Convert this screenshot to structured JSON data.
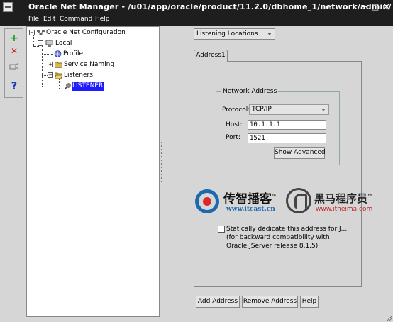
{
  "window": {
    "title": "Oracle Net Manager - /u01/app/oracle/product/11.2.0/dbhome_1/network/admin/",
    "buttons": {
      "minimize": "−",
      "maximize": "□",
      "close": "✕"
    }
  },
  "menu": {
    "file": "File",
    "edit": "Edit",
    "command": "Command",
    "help": "Help"
  },
  "toolbar": {
    "create_glyph": "+",
    "delete_glyph": "✕",
    "help_glyph": "?",
    "create_color": "#1a9b1a",
    "delete_color": "#d01818",
    "help_color": "#1a3fb0"
  },
  "tree": {
    "root": "Oracle Net Configuration",
    "local": "Local",
    "profile": "Profile",
    "service_naming": "Service Naming",
    "listeners": "Listeners",
    "listener": "LISTENER"
  },
  "view_selector": {
    "selected": "Listening Locations"
  },
  "tabs": {
    "address1": "Address1"
  },
  "network_address": {
    "group_title": "Network Address",
    "protocol_label": "Protocol:",
    "protocol_value": "TCP/IP",
    "host_label": "Host:",
    "host_value": "10.1.1.1",
    "port_label": "Port:",
    "port_value": "1521",
    "show_advanced": "Show Advanced"
  },
  "watermarks": {
    "itcast_name": "传智播客",
    "itcast_tm": "™",
    "itcast_url": "www.itcast.cn",
    "itheima_name": "黑马程序员",
    "itheima_tm": "™",
    "itheima_url": "www.itheima.com"
  },
  "static_dedicate": {
    "line1": "Statically dedicate this address for J...",
    "line2": "(for backward compatibility with",
    "line3": "Oracle JServer release 8.1.5)",
    "checked": false
  },
  "buttons": {
    "add_address": "Add Address",
    "remove_address": "Remove Address",
    "help": "Help"
  }
}
